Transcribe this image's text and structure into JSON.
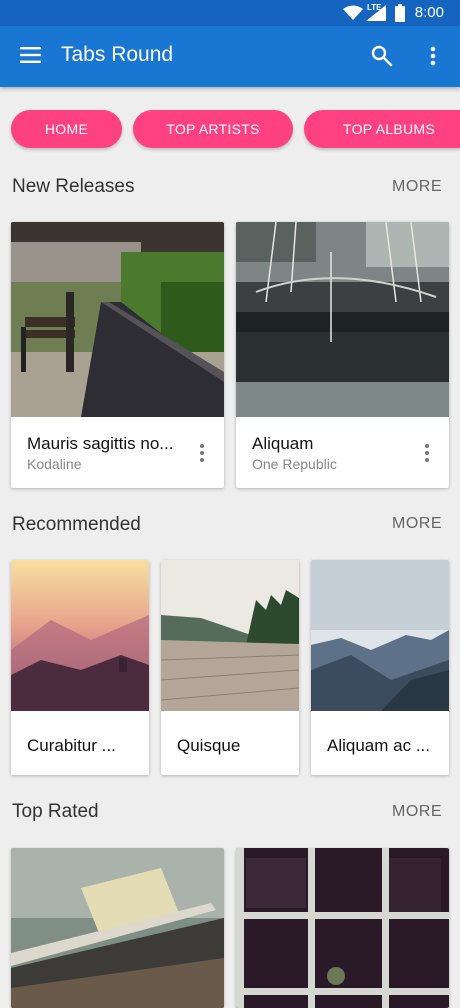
{
  "status": {
    "time": "8:00",
    "network": "LTE"
  },
  "appbar": {
    "title": "Tabs Round"
  },
  "tabs": [
    "HOME",
    "TOP ARTISTS",
    "TOP ALBUMS"
  ],
  "sections": {
    "new_releases": {
      "title": "New Releases",
      "more": "MORE",
      "items": [
        {
          "title": "Mauris sagittis no...",
          "subtitle": "Kodaline"
        },
        {
          "title": "Aliquam",
          "subtitle": "One Republic"
        }
      ]
    },
    "recommended": {
      "title": "Recommended",
      "more": "MORE",
      "items": [
        {
          "title": "Curabitur ..."
        },
        {
          "title": "Quisque"
        },
        {
          "title": "Aliquam ac ..."
        }
      ]
    },
    "top_rated": {
      "title": "Top Rated",
      "more": "MORE"
    }
  },
  "colors": {
    "status_bar": "#1565c0",
    "app_bar": "#1976d2",
    "tab_pill": "#ff4081",
    "background": "#eeeeee"
  }
}
